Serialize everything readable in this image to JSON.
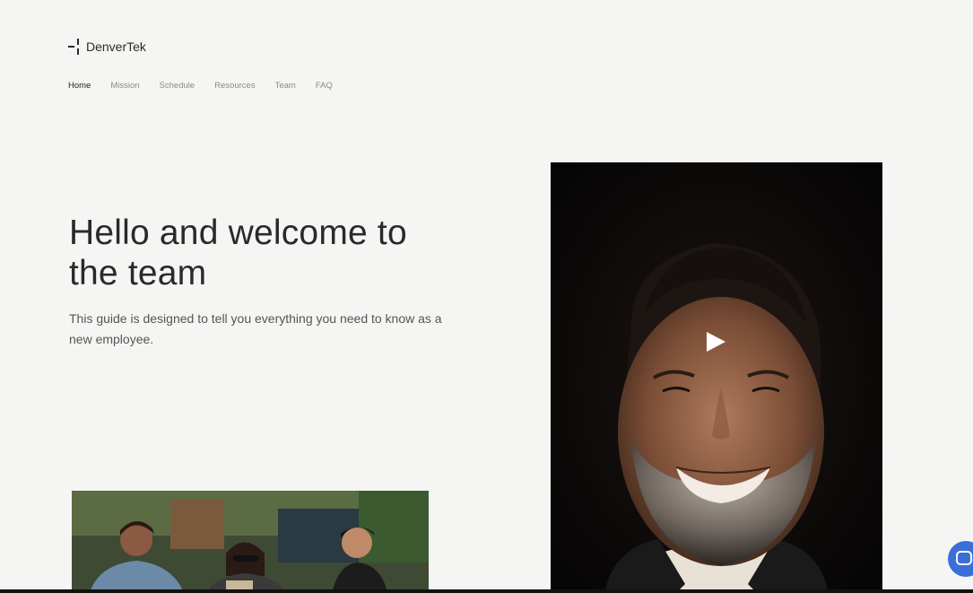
{
  "brand": {
    "name": "DenverTek"
  },
  "nav": {
    "items": [
      {
        "label": "Home",
        "active": true
      },
      {
        "label": "Mission",
        "active": false
      },
      {
        "label": "Schedule",
        "active": false
      },
      {
        "label": "Resources",
        "active": false
      },
      {
        "label": "Team",
        "active": false
      },
      {
        "label": "FAQ",
        "active": false
      }
    ]
  },
  "hero": {
    "title": "Hello and welcome to the team",
    "description": "This guide is designed to tell you everything you need to know as a new employee."
  },
  "video": {
    "icon": "play-icon"
  },
  "chat": {
    "icon": "chat-icon",
    "color": "#3b6fd8"
  }
}
